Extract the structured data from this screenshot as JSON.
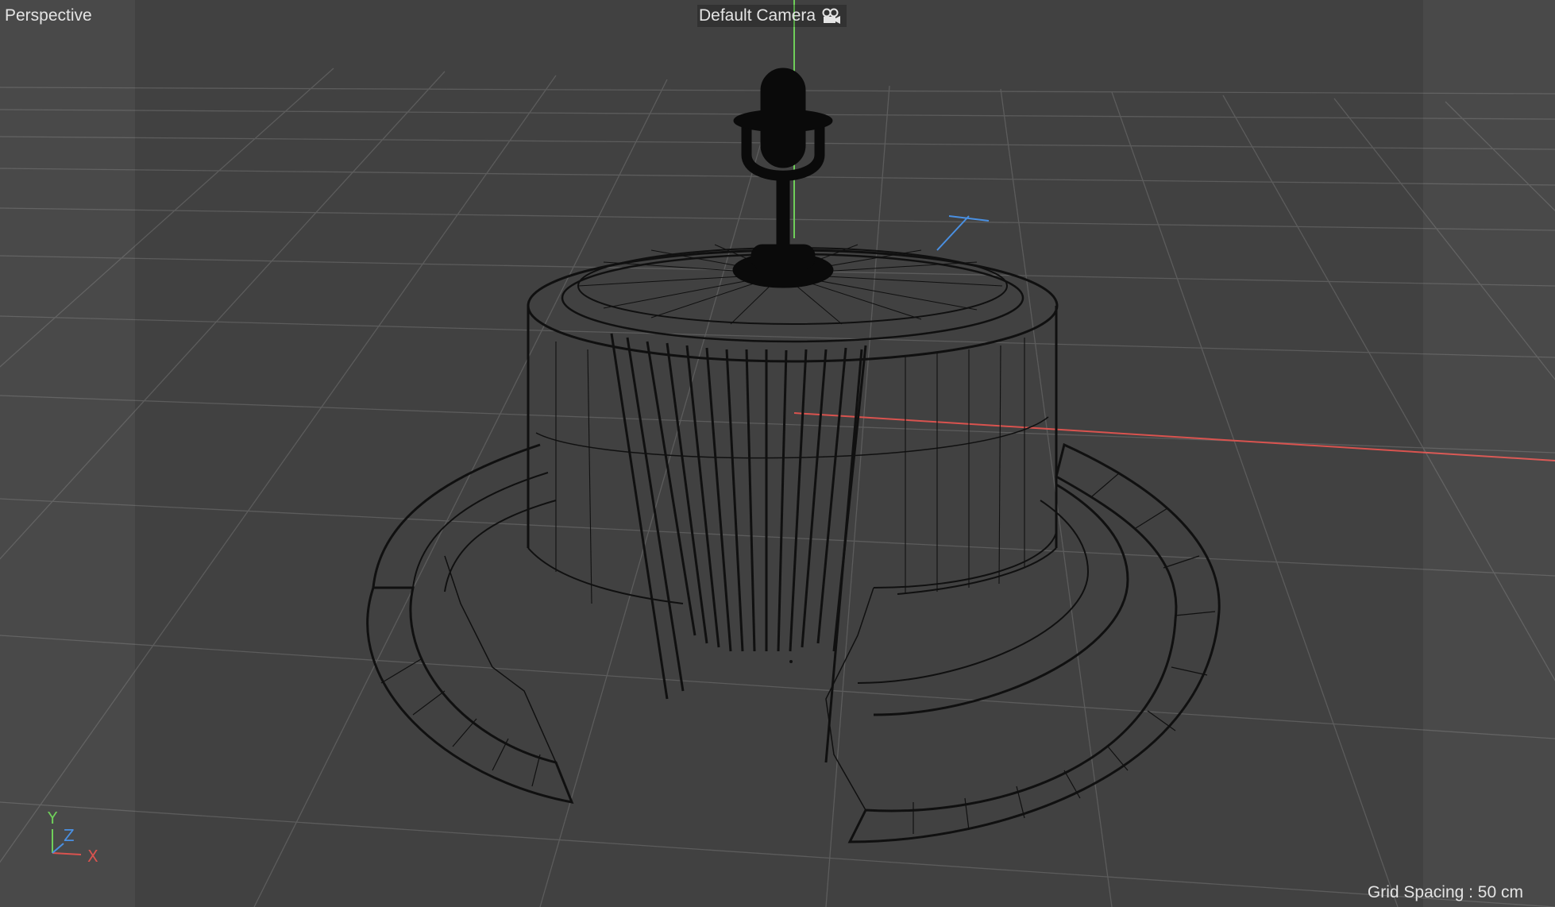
{
  "viewport": {
    "view_name": "Perspective",
    "camera_name": "Default Camera",
    "grid_spacing": "Grid Spacing : 50 cm",
    "camera_icon": "camera-icon"
  },
  "axis_gizmo": {
    "y_label": "Y",
    "z_label": "Z",
    "x_label": "X"
  },
  "colors": {
    "background": "#414141",
    "grid": "#5a5a5a",
    "wire": "#101010",
    "x_axis": "#d9534f",
    "y_axis": "#6fcf5a",
    "z_axis": "#4a90e2"
  },
  "scene_objects": [
    "microphone-icon",
    "cylinder-stage-mesh",
    "ring-stairs-mesh"
  ]
}
